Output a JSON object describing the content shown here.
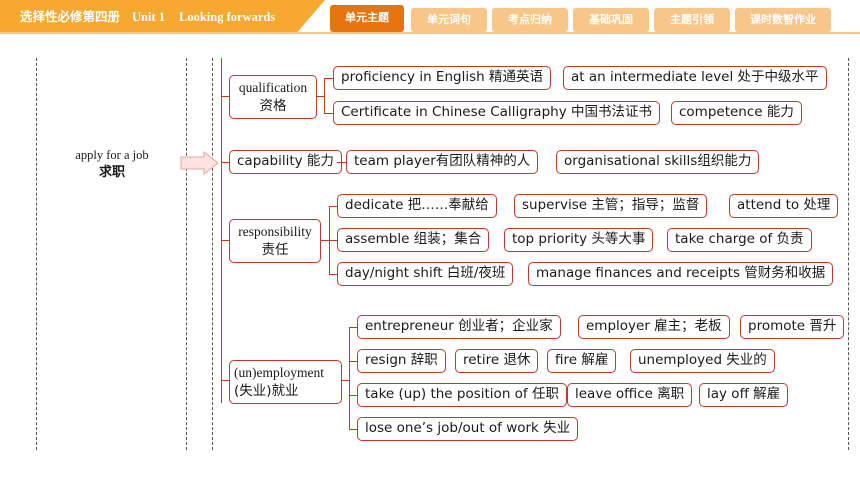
{
  "header": {
    "title_zh": "选择性必修第四册",
    "title_unit": "Unit 1",
    "title_en": "Looking forwards",
    "tabs": [
      {
        "label": "单元主题",
        "active": true
      },
      {
        "label": "单元词句",
        "active": false
      },
      {
        "label": "考点归纳",
        "active": false
      },
      {
        "label": "基础巩固",
        "active": false
      },
      {
        "label": "主题引领",
        "active": false
      },
      {
        "label": "课时数智作业",
        "active": false
      }
    ],
    "colors": {
      "accent": "#f7a830",
      "active_tab": "#e8740e",
      "inactive_tab": "#f9c68a",
      "box_border": "#c0392b"
    }
  },
  "topic": {
    "en": "apply for a job",
    "zh": "求职"
  },
  "categories": [
    {
      "label_en": "qualification",
      "label_zh": "资格",
      "items": [
        [
          "proficiency in English 精通英语",
          "at an intermediate level 处于中级水平"
        ],
        [
          "Certificate in Chinese Calligraphy 中国书法证书",
          "competence 能力"
        ]
      ]
    },
    {
      "label_en": "capability 能力",
      "label_zh": "",
      "items": [
        [
          "team player有团队精神的人",
          "organisational skills组织能力"
        ]
      ]
    },
    {
      "label_en": "responsibility",
      "label_zh": "责任",
      "items": [
        [
          "dedicate 把……奉献给",
          "supervise 主管；指导；监督",
          "attend to 处理"
        ],
        [
          "assemble 组装；集合",
          "top priority 头等大事",
          "take charge of 负责"
        ],
        [
          "day/night shift 白班/夜班",
          "manage finances and receipts 管财务和收据"
        ]
      ]
    },
    {
      "label_en": "(un)employment",
      "label_zh": "(失业)就业",
      "items": [
        [
          "entrepreneur 创业者；企业家",
          "employer 雇主；老板",
          "promote 晋升"
        ],
        [
          "resign 辞职",
          "retire 退休",
          "fire 解雇",
          "unemployed 失业的"
        ],
        [
          "take (up) the position of 任职",
          "leave office 离职",
          "lay off 解雇"
        ],
        [
          "lose one’s job/out of work 失业"
        ]
      ]
    }
  ]
}
